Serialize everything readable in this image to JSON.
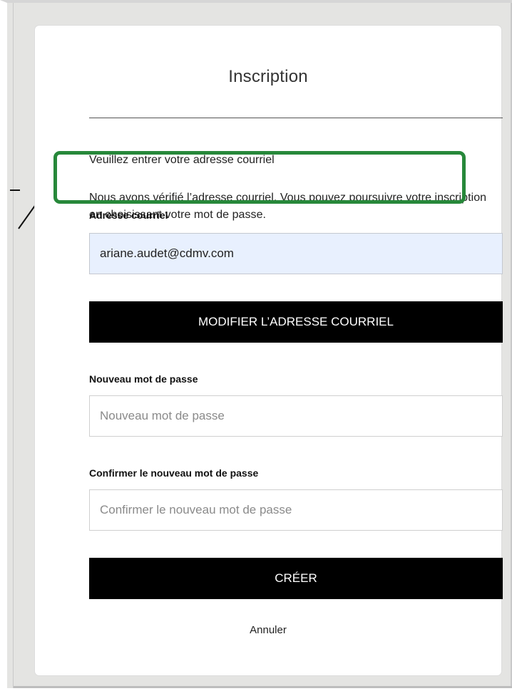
{
  "form": {
    "title": "Inscription",
    "intro": "Veuillez entrer votre adresse courriel",
    "verified_message": "Nous avons vérifié l’adresse courriel. Vous pouvez poursuivre votre inscription en choisissant votre mot de passe.",
    "email_label": "Adresse courriel",
    "email_value": "ariane.audet@cdmv.com",
    "modify_email_button": "MODIFIER L’ADRESSE COURRIEL",
    "new_password_label": "Nouveau mot de passe",
    "new_password_placeholder": "Nouveau mot de passe",
    "confirm_password_label": "Confirmer le nouveau mot de passe",
    "confirm_password_placeholder": "Confirmer le nouveau mot de passe",
    "create_button": "CRÉER",
    "cancel_link": "Annuler"
  },
  "colors": {
    "highlight_border": "#27883a",
    "button_bg": "#000000",
    "autofill_bg": "#e8f0fe"
  }
}
